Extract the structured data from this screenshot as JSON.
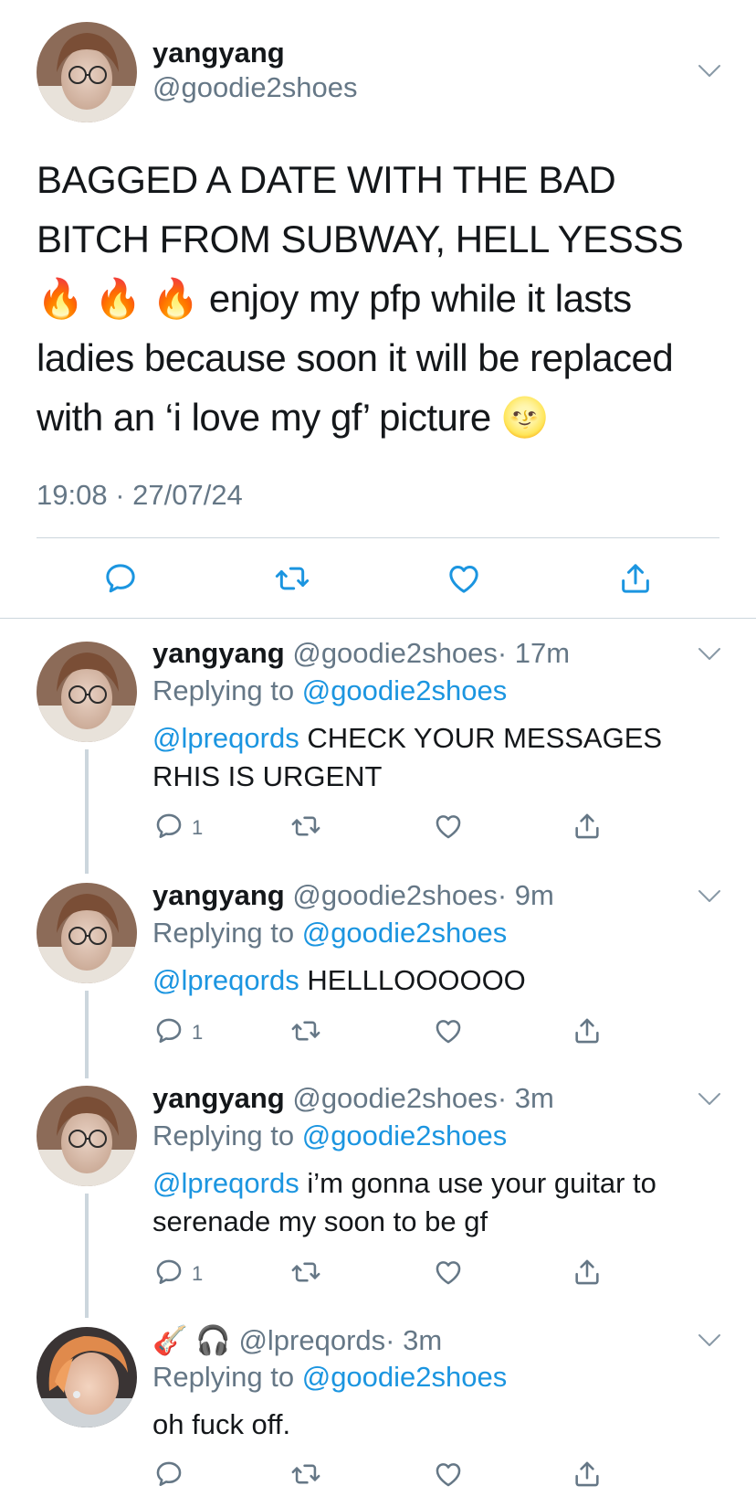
{
  "main_tweet": {
    "name": "yangyang",
    "handle": "@goodie2shoes",
    "text_line1": "BAGGED A DATE WITH THE BAD",
    "text_line2": "BITCH FROM SUBWAY, HELL YESSS",
    "text_line3": "enjoy my pfp while it lasts",
    "text_line4": "ladies because soon it will be replaced",
    "text_line5": "with an ‘i love my gf’ picture",
    "fire_emoji": "🔥",
    "moon_emoji": "🌝",
    "timestamp": "19:08 · 27/07/24"
  },
  "replies": [
    {
      "name": "yangyang",
      "handle": "@goodie2shoes",
      "time": "· 17m",
      "replying_prefix": "Replying to",
      "replying_to": "@goodie2shoes",
      "mention": "@lpreqords",
      "text": " CHECK YOUR MESSAGES",
      "text2": "RHIS IS URGENT",
      "reply_count": "1"
    },
    {
      "name": "yangyang",
      "handle": "@goodie2shoes",
      "time": "· 9m",
      "replying_prefix": "Replying to",
      "replying_to": "@goodie2shoes",
      "mention": "@lpreqords",
      "text": " HELLLOOOOOO",
      "reply_count": "1"
    },
    {
      "name": "yangyang",
      "handle": "@goodie2shoes",
      "time": "· 3m",
      "replying_prefix": "Replying to",
      "replying_to": "@goodie2shoes",
      "mention": "@lpreqords",
      "text": " i’m gonna use your guitar to",
      "text2": "serenade my soon to be gf",
      "reply_count": "1"
    },
    {
      "name_emoji": "🎸 🎧",
      "handle": "@lpreqords",
      "time": "· 3m",
      "replying_prefix": "Replying to",
      "replying_to": "@goodie2shoes",
      "text": "oh fuck off."
    }
  ],
  "icons": [
    "reply-icon",
    "retweet-icon",
    "like-icon",
    "share-icon",
    "chevron-down-icon"
  ],
  "colors": {
    "link": "#1b95e0",
    "secondary": "#657786",
    "divider": "#ccd6dd",
    "icon": "#657786",
    "main_icon": "#1b95e0"
  }
}
